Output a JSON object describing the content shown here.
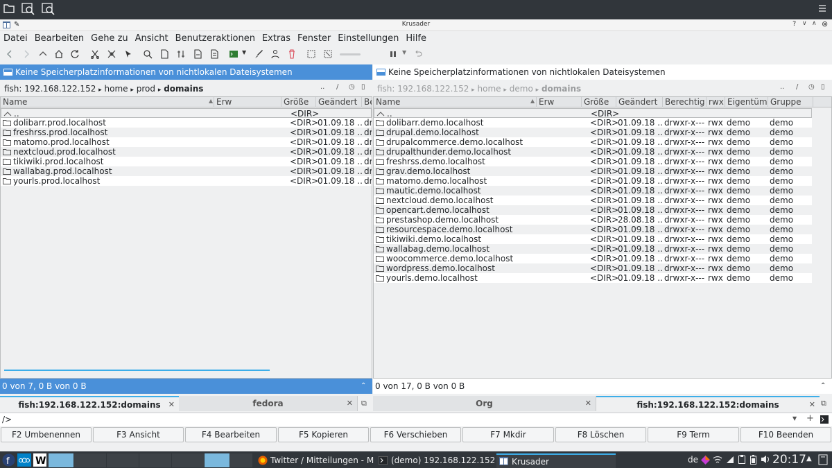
{
  "window": {
    "title": "Krusader"
  },
  "menu": [
    "Datei",
    "Bearbeiten",
    "Gehe zu",
    "Ansicht",
    "Benutzeraktionen",
    "Extras",
    "Fenster",
    "Einstellungen",
    "Hilfe"
  ],
  "left": {
    "info": "Keine Speicherplatzinformationen von nichtlokalen Dateisystemen",
    "path": {
      "host": "fish: 192.168.122.152",
      "sep": "▸",
      "p1": "home",
      "p2": "prod",
      "p3": "domains"
    },
    "buttons": {
      "up": "..",
      "root": "/"
    },
    "headers": [
      "Name",
      "Erw",
      "Größe",
      "Geändert",
      "Be"
    ],
    "updir": {
      "name": "..",
      "size": "<DIR>"
    },
    "rows": [
      {
        "name": "dolibarr.prod.localhost",
        "size": "<DIR>",
        "date": "01.09.18 ...",
        "perm": "dr"
      },
      {
        "name": "freshrss.prod.localhost",
        "size": "<DIR>",
        "date": "01.09.18 ...",
        "perm": "dr"
      },
      {
        "name": "matomo.prod.localhost",
        "size": "<DIR>",
        "date": "01.09.18 ...",
        "perm": "dr"
      },
      {
        "name": "nextcloud.prod.localhost",
        "size": "<DIR>",
        "date": "01.09.18 ...",
        "perm": "dr"
      },
      {
        "name": "tikiwiki.prod.localhost",
        "size": "<DIR>",
        "date": "01.09.18 ...",
        "perm": "dr"
      },
      {
        "name": "wallabag.prod.localhost",
        "size": "<DIR>",
        "date": "01.09.18 ...",
        "perm": "dr"
      },
      {
        "name": "yourls.prod.localhost",
        "size": "<DIR>",
        "date": "01.09.18 ...",
        "perm": "dr"
      }
    ],
    "status": "0 von 7, 0 B von 0 B",
    "tabs": [
      "fish:192.168.122.152:domains",
      "fedora"
    ]
  },
  "right": {
    "info": "Keine Speicherplatzinformationen von nichtlokalen Dateisystemen",
    "path": {
      "host": "fish: 192.168.122.152",
      "sep": "▸",
      "p1": "home",
      "p2": "demo",
      "p3": "domains"
    },
    "buttons": {
      "up": "..",
      "root": "/"
    },
    "headers": [
      "Name",
      "Erw",
      "Größe",
      "Geändert",
      "Berechtig",
      "rwx",
      "Eigentüm",
      "Gruppe"
    ],
    "updir": {
      "name": "..",
      "size": "<DIR>"
    },
    "rows": [
      {
        "name": "dolibarr.demo.localhost",
        "size": "<DIR>",
        "date": "01.09.18 ...",
        "perm": "drwxr-x---",
        "rwx": "rwx",
        "owner": "demo",
        "group": "demo"
      },
      {
        "name": "drupal.demo.localhost",
        "size": "<DIR>",
        "date": "01.09.18 ...",
        "perm": "drwxr-x---",
        "rwx": "rwx",
        "owner": "demo",
        "group": "demo"
      },
      {
        "name": "drupalcommerce.demo.localhost",
        "size": "<DIR>",
        "date": "01.09.18 ...",
        "perm": "drwxr-x---",
        "rwx": "rwx",
        "owner": "demo",
        "group": "demo"
      },
      {
        "name": "drupalthunder.demo.localhost",
        "size": "<DIR>",
        "date": "01.09.18 ...",
        "perm": "drwxr-x---",
        "rwx": "rwx",
        "owner": "demo",
        "group": "demo"
      },
      {
        "name": "freshrss.demo.localhost",
        "size": "<DIR>",
        "date": "01.09.18 ...",
        "perm": "drwxr-x---",
        "rwx": "rwx",
        "owner": "demo",
        "group": "demo"
      },
      {
        "name": "grav.demo.localhost",
        "size": "<DIR>",
        "date": "01.09.18 ...",
        "perm": "drwxr-x---",
        "rwx": "rwx",
        "owner": "demo",
        "group": "demo"
      },
      {
        "name": "matomo.demo.localhost",
        "size": "<DIR>",
        "date": "01.09.18 ...",
        "perm": "drwxr-x---",
        "rwx": "rwx",
        "owner": "demo",
        "group": "demo"
      },
      {
        "name": "mautic.demo.localhost",
        "size": "<DIR>",
        "date": "01.09.18 ...",
        "perm": "drwxr-x---",
        "rwx": "rwx",
        "owner": "demo",
        "group": "demo"
      },
      {
        "name": "nextcloud.demo.localhost",
        "size": "<DIR>",
        "date": "01.09.18 ...",
        "perm": "drwxr-x---",
        "rwx": "rwx",
        "owner": "demo",
        "group": "demo"
      },
      {
        "name": "opencart.demo.localhost",
        "size": "<DIR>",
        "date": "01.09.18 ...",
        "perm": "drwxr-x---",
        "rwx": "rwx",
        "owner": "demo",
        "group": "demo"
      },
      {
        "name": "prestashop.demo.localhost",
        "size": "<DIR>",
        "date": "28.08.18 ...",
        "perm": "drwxr-x---",
        "rwx": "rwx",
        "owner": "demo",
        "group": "demo"
      },
      {
        "name": "resourcespace.demo.localhost",
        "size": "<DIR>",
        "date": "01.09.18 ...",
        "perm": "drwxr-x---",
        "rwx": "rwx",
        "owner": "demo",
        "group": "demo"
      },
      {
        "name": "tikiwiki.demo.localhost",
        "size": "<DIR>",
        "date": "01.09.18 ...",
        "perm": "drwxr-x---",
        "rwx": "rwx",
        "owner": "demo",
        "group": "demo"
      },
      {
        "name": "wallabag.demo.localhost",
        "size": "<DIR>",
        "date": "01.09.18 ...",
        "perm": "drwxr-x---",
        "rwx": "rwx",
        "owner": "demo",
        "group": "demo"
      },
      {
        "name": "woocommerce.demo.localhost",
        "size": "<DIR>",
        "date": "01.09.18 ...",
        "perm": "drwxr-x---",
        "rwx": "rwx",
        "owner": "demo",
        "group": "demo"
      },
      {
        "name": "wordpress.demo.localhost",
        "size": "<DIR>",
        "date": "01.09.18 ...",
        "perm": "drwxr-x---",
        "rwx": "rwx",
        "owner": "demo",
        "group": "demo"
      },
      {
        "name": "yourls.demo.localhost",
        "size": "<DIR>",
        "date": "01.09.18 ...",
        "perm": "drwxr-x---",
        "rwx": "rwx",
        "owner": "demo",
        "group": "demo"
      }
    ],
    "status": "0 von 17, 0 B von 0 B",
    "tabs": [
      "Org",
      "fish:192.168.122.152:domains"
    ]
  },
  "cmdline": {
    "prompt": "/>"
  },
  "fkeys": [
    "F2 Umbenennen",
    "F3 Ansicht",
    "F4 Bearbeiten",
    "F5 Kopieren",
    "F6 Verschieben",
    "F7 Mkdir",
    "F8 Löschen",
    "F9 Term",
    "F10 Beenden"
  ],
  "taskbar": {
    "tasks": [
      "Twitter / Mitteilungen - M...",
      "(demo) 192.168.122.152 ...",
      "Krusader"
    ],
    "lang": "de",
    "clock": "20:17"
  },
  "colors": {
    "accent": "#3daee9",
    "selection": "#4a90d9",
    "dark": "#31363b"
  }
}
